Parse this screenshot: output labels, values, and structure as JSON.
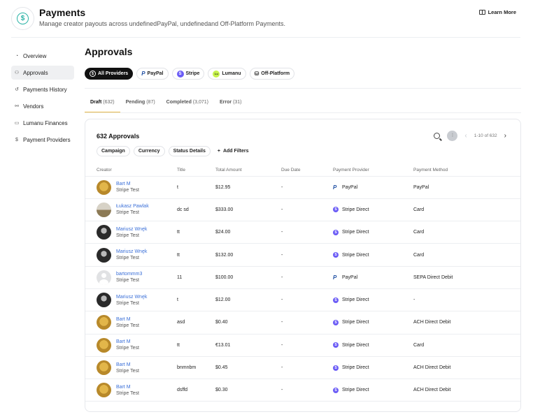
{
  "header": {
    "logo_glyph": "$",
    "title": "Payments",
    "subtitle": "Manage creator payouts across undefinedPayPal, undefinedand Off-Platform Payments.",
    "learn_more": "Learn More"
  },
  "sidebar": {
    "items": [
      {
        "label": "Overview",
        "icon": "dashboard-icon",
        "glyph": "◔",
        "active": false
      },
      {
        "label": "Approvals",
        "icon": "user-check-icon",
        "glyph": "⚇",
        "active": true
      },
      {
        "label": "Payments History",
        "icon": "history-icon",
        "glyph": "↺",
        "active": false
      },
      {
        "label": "Vendors",
        "icon": "vendors-icon",
        "glyph": "⚯",
        "active": false
      },
      {
        "label": "Lumanu Finances",
        "icon": "wallet-icon",
        "glyph": "▭",
        "active": false
      },
      {
        "label": "Payment Providers",
        "icon": "coin-icon",
        "glyph": "$",
        "active": false
      }
    ]
  },
  "main": {
    "title": "Approvals",
    "providers": [
      {
        "label": "All Providers",
        "icon": "all-providers-icon",
        "glyph": "$",
        "active": true
      },
      {
        "label": "PayPal",
        "icon": "paypal-icon",
        "glyph": "P",
        "active": false
      },
      {
        "label": "Stripe",
        "icon": "stripe-icon",
        "glyph": "S",
        "active": false
      },
      {
        "label": "Lumanu",
        "icon": "lumanu-icon",
        "glyph": "Lu",
        "active": false
      },
      {
        "label": "Off-Platform",
        "icon": "off-platform-icon",
        "glyph": "⛁",
        "active": false
      }
    ],
    "tabs": [
      {
        "label": "Draft",
        "count": "(632)",
        "active": true
      },
      {
        "label": "Pending",
        "count": "(87)",
        "active": false
      },
      {
        "label": "Completed",
        "count": "(3,071)",
        "active": false
      },
      {
        "label": "Error",
        "count": "(31)",
        "active": false
      }
    ]
  },
  "card": {
    "title": "632 Approvals",
    "pagination": "1-10 of 632",
    "filters": [
      "Campaign",
      "Currency",
      "Status Details"
    ],
    "add_filters": "Add Filters",
    "columns": [
      "Creator",
      "Title",
      "Total Amount",
      "Due Date",
      "Payment Provider",
      "Payment Method"
    ],
    "rows": [
      {
        "name": "Bart M",
        "sub": "Stripe Test",
        "avatar": "gold",
        "title": "t",
        "amount": "$12.95",
        "due": "-",
        "provider": "PayPal",
        "provider_type": "paypal",
        "method": "PayPal"
      },
      {
        "name": "Łukasz Pawlak",
        "sub": "Stripe Test",
        "avatar": "landscape",
        "title": "dc sd",
        "amount": "$333.00",
        "due": "-",
        "provider": "Stripe Direct",
        "provider_type": "stripe",
        "method": "Card"
      },
      {
        "name": "Mariusz Wnęk",
        "sub": "Stripe Test",
        "avatar": "dark",
        "title": "tt",
        "amount": "$24.00",
        "due": "-",
        "provider": "Stripe Direct",
        "provider_type": "stripe",
        "method": "Card"
      },
      {
        "name": "Mariusz Wnęk",
        "sub": "Stripe Test",
        "avatar": "dark",
        "title": "tt",
        "amount": "$132.00",
        "due": "-",
        "provider": "Stripe Direct",
        "provider_type": "stripe",
        "method": "Card"
      },
      {
        "name": "bartommm3",
        "sub": "Stripe Test",
        "avatar": "grey",
        "title": "11",
        "amount": "$100.00",
        "due": "-",
        "provider": "PayPal",
        "provider_type": "paypal",
        "method": "SEPA Direct Debit"
      },
      {
        "name": "Mariusz Wnęk",
        "sub": "Stripe Test",
        "avatar": "dark",
        "title": "t",
        "amount": "$12.00",
        "due": "-",
        "provider": "Stripe Direct",
        "provider_type": "stripe",
        "method": "-"
      },
      {
        "name": "Bart M",
        "sub": "Stripe Test",
        "avatar": "gold",
        "title": "asd",
        "amount": "$0.40",
        "due": "-",
        "provider": "Stripe Direct",
        "provider_type": "stripe",
        "method": "ACH Direct Debit"
      },
      {
        "name": "Bart M",
        "sub": "Stripe Test",
        "avatar": "gold",
        "title": "tt",
        "amount": "€13.01",
        "due": "-",
        "provider": "Stripe Direct",
        "provider_type": "stripe",
        "method": "Card"
      },
      {
        "name": "Bart M",
        "sub": "Stripe Test",
        "avatar": "gold",
        "title": "bnmnbm",
        "amount": "$0.45",
        "due": "-",
        "provider": "Stripe Direct",
        "provider_type": "stripe",
        "method": "ACH Direct Debit"
      },
      {
        "name": "Bart M",
        "sub": "Stripe Test",
        "avatar": "gold",
        "title": "dsffd",
        "amount": "$0.30",
        "due": "-",
        "provider": "Stripe Direct",
        "provider_type": "stripe",
        "method": "ACH Direct Debit"
      }
    ]
  },
  "colors": {
    "accent_tab": "#e9b947",
    "link": "#3a6fd8",
    "stripe": "#6b5cf6",
    "paypal": "#1f4fa3",
    "lumanu": "#c6f24b",
    "brand": "#2bb3a6"
  }
}
